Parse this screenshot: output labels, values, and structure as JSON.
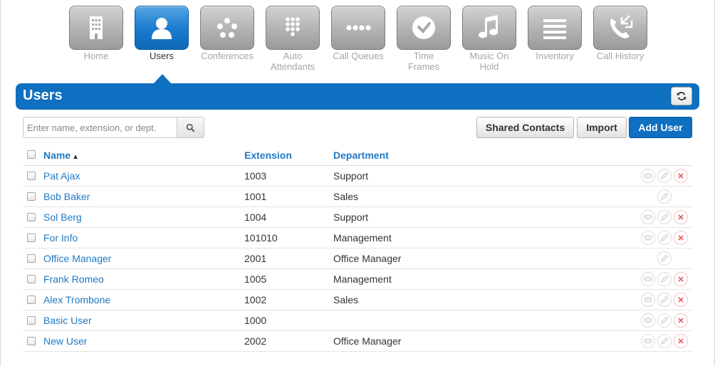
{
  "nav": {
    "items": [
      {
        "label": "Home",
        "icon": "building-icon"
      },
      {
        "label": "Users",
        "icon": "user-icon"
      },
      {
        "label": "Conferences",
        "icon": "conference-icon"
      },
      {
        "label": "Auto Attendants",
        "icon": "keypad-icon"
      },
      {
        "label": "Call Queues",
        "icon": "queue-dots-icon"
      },
      {
        "label": "Time Frames",
        "icon": "clock-icon"
      },
      {
        "label": "Music On Hold",
        "icon": "music-note-icon"
      },
      {
        "label": "Inventory",
        "icon": "list-lines-icon"
      },
      {
        "label": "Call History",
        "icon": "phone-arrows-icon"
      }
    ],
    "active": "Users"
  },
  "panel": {
    "title": "Users"
  },
  "search": {
    "placeholder": "Enter name, extension, or dept.",
    "value": ""
  },
  "toolbar": {
    "shared_contacts_label": "Shared Contacts",
    "import_label": "Import",
    "add_user_label": "Add User"
  },
  "table": {
    "columns": {
      "name": "Name",
      "extension": "Extension",
      "department": "Department"
    },
    "sort": {
      "column": "Name",
      "direction": "ascending"
    },
    "rows": [
      {
        "name": "Pat Ajax",
        "extension": "1003",
        "department": "Support",
        "actions": [
          "mask",
          "edit",
          "delete"
        ]
      },
      {
        "name": "Bob Baker",
        "extension": "1001",
        "department": "Sales",
        "actions": [
          "edit"
        ]
      },
      {
        "name": "Sol Berg",
        "extension": "1004",
        "department": "Support",
        "actions": [
          "mask",
          "edit",
          "delete"
        ]
      },
      {
        "name": "For Info",
        "extension": "101010",
        "department": "Management",
        "actions": [
          "mask",
          "edit",
          "delete"
        ]
      },
      {
        "name": "Office Manager",
        "extension": "2001",
        "department": "Office Manager",
        "actions": [
          "edit"
        ]
      },
      {
        "name": "Frank Romeo",
        "extension": "1005",
        "department": "Management",
        "actions": [
          "mask",
          "edit",
          "delete"
        ]
      },
      {
        "name": "Alex Trombone",
        "extension": "1002",
        "department": "Sales",
        "actions": [
          "mask",
          "edit",
          "delete"
        ]
      },
      {
        "name": "Basic User",
        "extension": "1000",
        "department": "",
        "actions": [
          "mask",
          "edit",
          "delete"
        ]
      },
      {
        "name": "New User",
        "extension": "2002",
        "department": "Office Manager",
        "actions": [
          "mask",
          "edit",
          "delete"
        ]
      }
    ]
  },
  "colors": {
    "accent": "#0f6fc1",
    "link": "#1f7ac6",
    "delete": "#e85c5c"
  }
}
